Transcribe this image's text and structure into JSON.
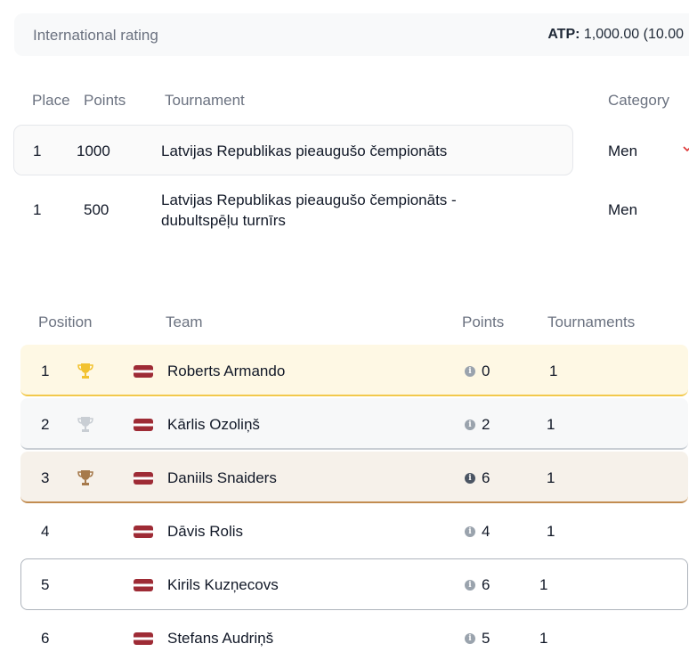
{
  "rating": {
    "label": "International rating",
    "atp_key": "ATP:",
    "atp_value": " 1,000.00 (10.00"
  },
  "tournaments": {
    "headers": {
      "place": "Place",
      "points": "Points",
      "tournament": "Tournament",
      "category": "Category"
    },
    "rows": [
      {
        "place": "1",
        "points": "1000",
        "name": "Latvijas Republikas pieaugušo čempionāts",
        "category": "Men"
      },
      {
        "place": "1",
        "points": "500",
        "name": "Latvijas Republikas pieaugušo čempionāts - dubultspēļu turnīrs",
        "category": "Men"
      }
    ]
  },
  "standings": {
    "headers": {
      "position": "Position",
      "team": "Team",
      "points": "Points",
      "tournaments": "Tournaments"
    },
    "rows": [
      {
        "position": "1",
        "trophy": "gold",
        "name": "Roberts Armando",
        "points": "0",
        "tournaments": "1"
      },
      {
        "position": "2",
        "trophy": "silver",
        "name": "Kārlis Ozoliņš",
        "points": "2",
        "tournaments": "1"
      },
      {
        "position": "3",
        "trophy": "bronze",
        "name": "Daniils Snaiders",
        "points": "6",
        "tournaments": "1"
      },
      {
        "position": "4",
        "name": "Dāvis Rolis",
        "points": "4",
        "tournaments": "1"
      },
      {
        "position": "5",
        "name": "Kirils Kuzņecovs",
        "points": "6",
        "tournaments": "1"
      },
      {
        "position": "6",
        "name": "Stefans Audriņš",
        "points": "5",
        "tournaments": "1"
      }
    ],
    "colors": {
      "gold": "#f2c94c",
      "silver": "#c9ced4",
      "bronze": "#c28c50"
    }
  }
}
